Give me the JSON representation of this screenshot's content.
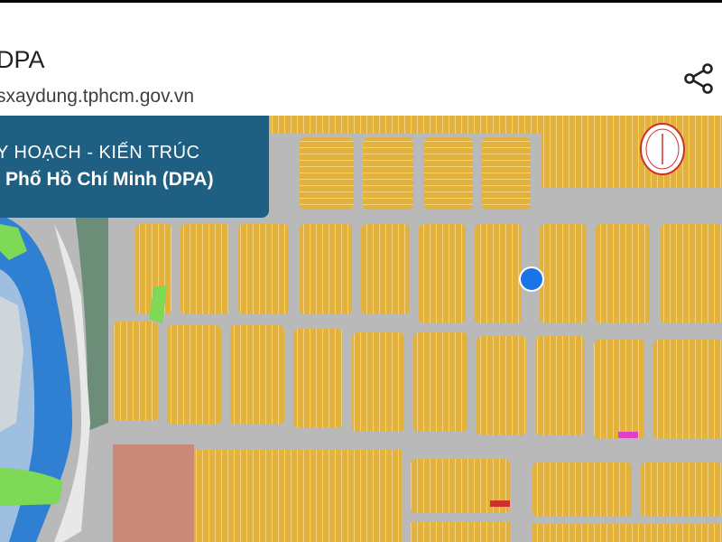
{
  "header": {
    "title": "DPA",
    "url": "sxaydung.tphcm.gov.vn"
  },
  "banner": {
    "line1": "Y HOẠCH - KIẾN TRÚC",
    "line2": "Phố Hồ Chí Minh (DPA)"
  },
  "icons": {
    "share": "share-icon",
    "location": "current-location-icon"
  },
  "colors": {
    "banner": "#1f5f82",
    "residential": "#e3b23c",
    "road": "#b9b9b9",
    "river": "#2f7fd3",
    "greenery": "#7ed957",
    "location": "#1a73e8"
  }
}
